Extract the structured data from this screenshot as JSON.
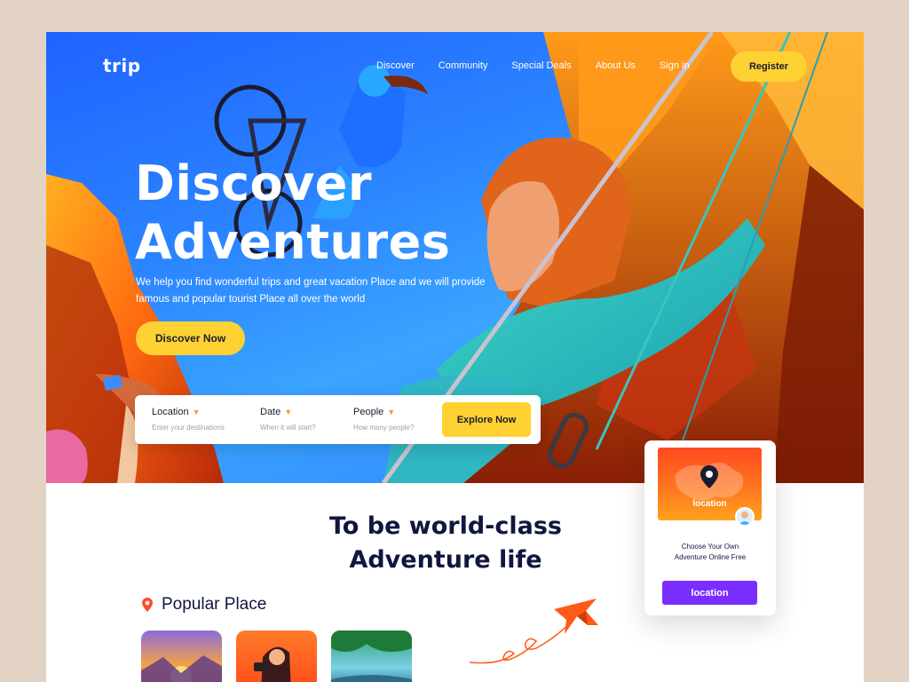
{
  "brand": {
    "logo": "trip"
  },
  "nav": {
    "items": [
      "Discover",
      "Community",
      "Special Deals",
      "About Us",
      "Sign in"
    ],
    "register": "Register"
  },
  "hero": {
    "title_line1": "Discover",
    "title_line2": "Adventures",
    "subtitle": "We help you find wonderful trips and great vacation Place and we will provide famous and popular tourist Place all over the world",
    "cta": "Discover Now"
  },
  "search": {
    "fields": [
      {
        "label": "Location",
        "placeholder": "Enter your destinations"
      },
      {
        "label": "Date",
        "placeholder": "When it will start?"
      },
      {
        "label": "People",
        "placeholder": "How many people?"
      }
    ],
    "button": "Explore Now"
  },
  "section": {
    "title_line1": "To be world-class",
    "title_line2": "Adventure life"
  },
  "popular": {
    "label": "Popular Place",
    "icon": "map-pin-icon"
  },
  "location_card": {
    "image_label": "location",
    "text_line1": "Choose Your Own",
    "text_line2": "Adventure Online Free",
    "button": "location"
  },
  "colors": {
    "accent_yellow": "#ffd233",
    "hero_blue": "#2b83ff",
    "dark_navy": "#11163f",
    "purple": "#7a2dff",
    "pin_red": "#ff4a2f"
  }
}
